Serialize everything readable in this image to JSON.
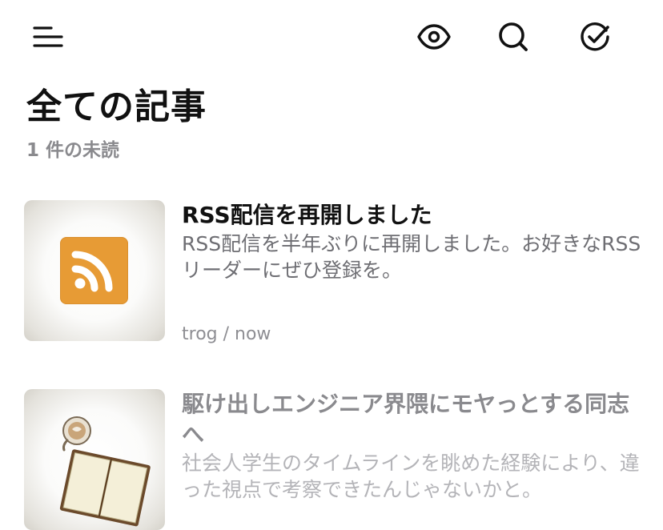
{
  "toolbar": {
    "icons": [
      "menu-icon",
      "eye-icon",
      "search-icon",
      "check-circle-icon"
    ]
  },
  "header": {
    "title": "全ての記事",
    "subtitle": "1 件の未読"
  },
  "articles": [
    {
      "title": "RSS配信を再開しました",
      "description": "RSS配信を半年ぶりに再開しました。お好きなRSSリーダーにぜひ登録を。",
      "meta": "trog / now",
      "thumbnail": "rss-feed-image",
      "read": false
    },
    {
      "title": "駆け出しエンジニア界隈にモヤっとする同志へ",
      "description": "社会人学生のタイムラインを眺めた経験により、違った視点で考察できたんじゃないかと。",
      "thumbnail": "coffee-and-notebook-image",
      "read": true
    }
  ],
  "colors": {
    "text": "#111111",
    "secondary": "#8a8a8e",
    "rss_orange": "#e79b35"
  }
}
